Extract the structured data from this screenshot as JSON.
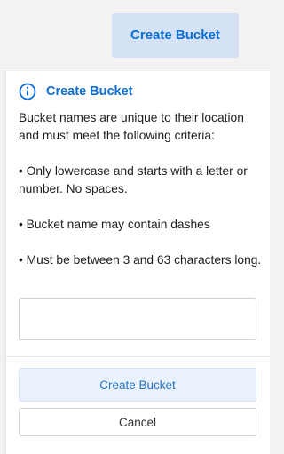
{
  "header": {
    "create_button_label": "Create Bucket"
  },
  "panel": {
    "icon": "info-icon",
    "title": "Create Bucket",
    "description": "Bucket names are unique to their location and must meet the following criteria:",
    "rules": [
      "• Only lowercase and starts with a letter or number. No spaces.",
      "• Bucket name may contain dashes",
      "• Must be between 3 and 63 characters long."
    ],
    "bucket_name_input": {
      "value": "",
      "placeholder": ""
    },
    "submit_label": "Create Bucket",
    "cancel_label": "Cancel"
  },
  "colors": {
    "accent": "#0a6fd6",
    "accent_bg": "#d5e2f6",
    "submit_bg": "#e9f1fc"
  }
}
